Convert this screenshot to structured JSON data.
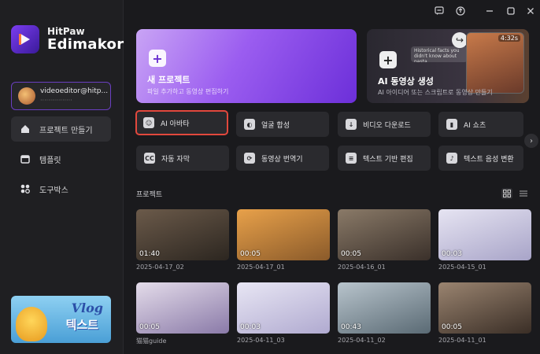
{
  "window": {
    "icons": [
      "feedback-icon",
      "upload-icon",
      "minimize-icon",
      "maximize-icon",
      "close-icon"
    ]
  },
  "sidebar": {
    "logo_line1": "HitPaw",
    "logo_line2": "Edimakor",
    "account_name": "videoeditor@hitp...",
    "account_sub": "················",
    "items": [
      {
        "label": "프로젝트 만들기",
        "icon": "home-icon",
        "active": true
      },
      {
        "label": "템플릿",
        "icon": "template-icon",
        "active": false
      },
      {
        "label": "도구박스",
        "icon": "toolbox-icon",
        "active": false
      }
    ],
    "promo_title": "Vlog",
    "promo_sub": "텍스트"
  },
  "hero": {
    "new_project_title": "새 프로젝트",
    "new_project_sub": "파일 추가하고 동영상 편집하기",
    "ai_video_title": "AI 동영상 생성",
    "ai_video_sub": "AI 아이디어 또는 스크립트로 동영상 만들기",
    "ai_video_badge": "4:32s",
    "ai_video_caption": "Historical facts you didn't know about pasta"
  },
  "tools": [
    {
      "label": "AI 아바타",
      "icon": "avatar-icon",
      "selected": true
    },
    {
      "label": "얼굴 합성",
      "icon": "face-swap-icon",
      "selected": false
    },
    {
      "label": "비디오 다운로드",
      "icon": "download-icon",
      "selected": false
    },
    {
      "label": "AI 쇼츠",
      "icon": "shorts-icon",
      "selected": false
    },
    {
      "label": "자동 자막",
      "icon": "cc-icon",
      "selected": false
    },
    {
      "label": "동영상 번역기",
      "icon": "translate-icon",
      "selected": false
    },
    {
      "label": "텍스트 기반 편집",
      "icon": "text-edit-icon",
      "selected": false
    },
    {
      "label": "텍스트 음성 변환",
      "icon": "tts-icon",
      "selected": false
    }
  ],
  "projects": {
    "title": "프로젝트",
    "items": [
      {
        "name": "2025-04-17_02",
        "duration": "01:40",
        "color1": "#6b5a4a",
        "color2": "#2c2620"
      },
      {
        "name": "2025-04-17_01",
        "duration": "00:05",
        "color1": "#e8a14a",
        "color2": "#8a5a2a"
      },
      {
        "name": "2025-04-16_01",
        "duration": "00:05",
        "color1": "#8a7a68",
        "color2": "#3a302a"
      },
      {
        "name": "2025-04-15_01",
        "duration": "00:03",
        "color1": "#e6e4f2",
        "color2": "#a8a4c8"
      },
      {
        "name": "猫猫guide",
        "duration": "00:05",
        "color1": "#e4dcea",
        "color2": "#8a7aa8"
      },
      {
        "name": "2025-04-11_03",
        "duration": "00:03",
        "color1": "#e8e6f4",
        "color2": "#b0aad0"
      },
      {
        "name": "2025-04-11_02",
        "duration": "00:43",
        "color1": "#b8c4cc",
        "color2": "#5a6a74"
      },
      {
        "name": "2025-04-11_01",
        "duration": "00:05",
        "color1": "#9a8470",
        "color2": "#3a2e26"
      }
    ]
  }
}
